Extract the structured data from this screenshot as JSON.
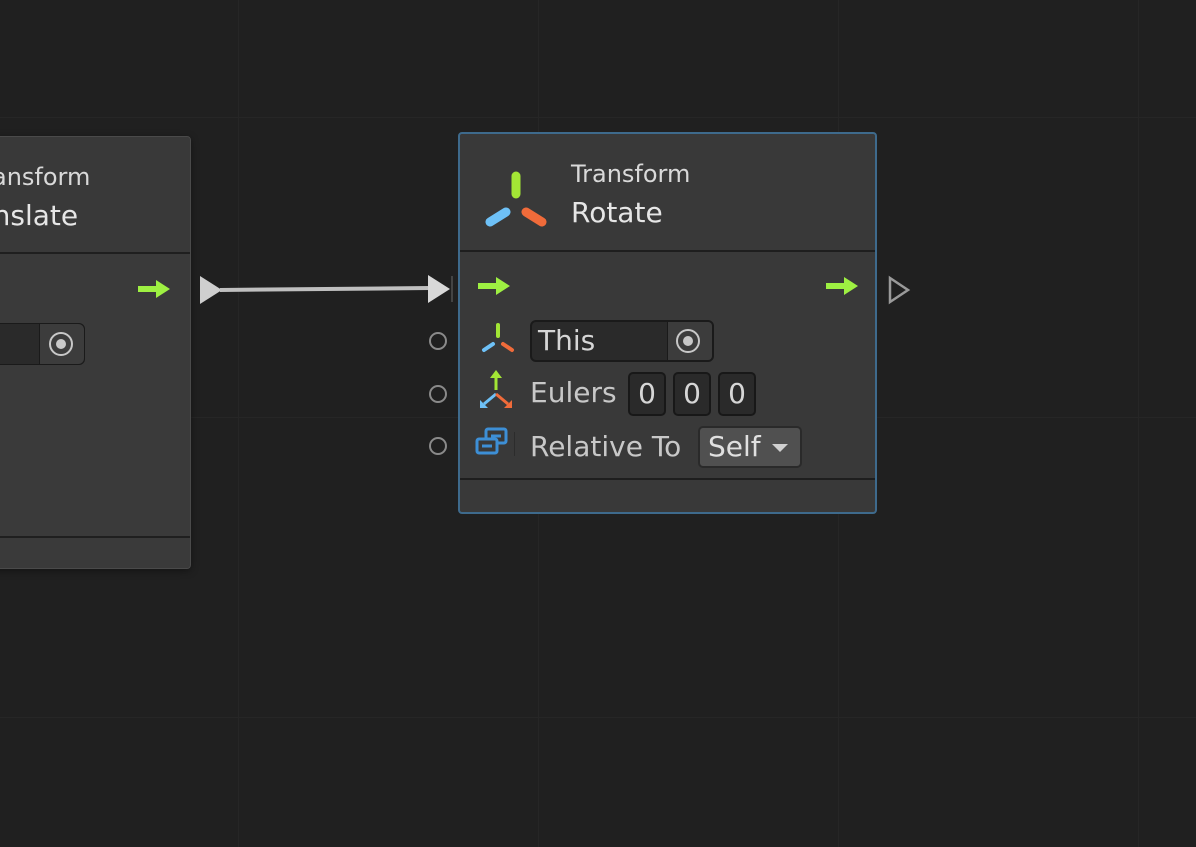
{
  "left_node": {
    "category": "Transform",
    "title": "Translate"
  },
  "rotate_node": {
    "category": "Transform",
    "title": "Rotate",
    "fields": {
      "target_value": "This",
      "eulers_label": "Eulers",
      "eulers": [
        "0",
        "0",
        "0"
      ],
      "relative_to_label": "Relative To",
      "relative_to_value": "Self"
    }
  },
  "colors": {
    "background": "#202020",
    "node_bg": "#393939",
    "selected_border": "#3e6a8c",
    "flow_arrow": "#9ef042",
    "icon_green": "#a3e635",
    "icon_blue": "#6ec1f7",
    "icon_orange": "#f06b3a"
  }
}
